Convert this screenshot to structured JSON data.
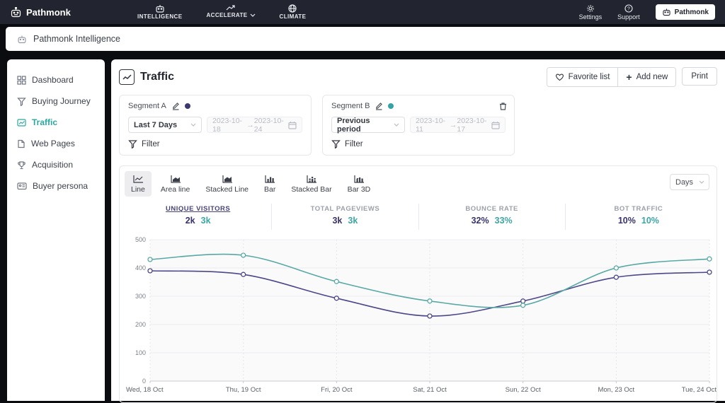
{
  "topbar": {
    "brand": "Pathmonk",
    "menu": [
      {
        "label": "INTELLIGENCE",
        "icon": "robot-icon",
        "chevron": false
      },
      {
        "label": "ACCELERATE",
        "icon": "trend-up-icon",
        "chevron": true
      },
      {
        "label": "CLIMATE",
        "icon": "globe-icon",
        "chevron": false
      }
    ],
    "actions": [
      {
        "label": "Settings",
        "icon": "gear-icon"
      },
      {
        "label": "Support",
        "icon": "help-icon"
      }
    ],
    "account_button": "Pathmonk"
  },
  "breadcrumb": {
    "label": "Pathmonk Intelligence",
    "icon": "robot-icon"
  },
  "sidebar": {
    "items": [
      {
        "label": "Dashboard",
        "icon": "dashboard-icon",
        "active": false
      },
      {
        "label": "Buying Journey",
        "icon": "funnel-icon",
        "active": false
      },
      {
        "label": "Traffic",
        "icon": "traffic-chart-icon",
        "active": true
      },
      {
        "label": "Web Pages",
        "icon": "document-icon",
        "active": false
      },
      {
        "label": "Acquisition",
        "icon": "trophy-icon",
        "active": false
      },
      {
        "label": "Buyer persona",
        "icon": "id-card-icon",
        "active": false
      }
    ]
  },
  "page": {
    "title": "Traffic",
    "favorite_button": "Favorite list",
    "add_new_button": "Add new",
    "print_button": "Print"
  },
  "segments": [
    {
      "name": "Segment A",
      "color": "#3c3870",
      "period": "Last 7 Days",
      "date_from": "2023-10-18",
      "date_to": "2023-10-24",
      "arrow": "→",
      "filter_label": "Filter",
      "deletable": false
    },
    {
      "name": "Segment B",
      "color": "#35a3a3",
      "period": "Previous period",
      "date_from": "2023-10-11",
      "date_to": "2023-10-17",
      "arrow": "→",
      "filter_label": "Filter",
      "deletable": true
    }
  ],
  "chart_controls": {
    "types": [
      {
        "label": "Line",
        "icon": "line-chart-icon",
        "active": true
      },
      {
        "label": "Area line",
        "icon": "area-chart-icon",
        "active": false
      },
      {
        "label": "Stacked Line",
        "icon": "stacked-area-icon",
        "active": false
      },
      {
        "label": "Bar",
        "icon": "bar-chart-icon",
        "active": false
      },
      {
        "label": "Stacked Bar",
        "icon": "stacked-bar-icon",
        "active": false
      },
      {
        "label": "Bar 3D",
        "icon": "bar-3d-icon",
        "active": false
      }
    ],
    "granularity": "Days"
  },
  "metrics": [
    {
      "label": "UNIQUE VISITORS",
      "value_a": "2k",
      "value_b": "3k",
      "active": true
    },
    {
      "label": "TOTAL PAGEVIEWS",
      "value_a": "3k",
      "value_b": "3k",
      "active": false
    },
    {
      "label": "BOUNCE RATE",
      "value_a": "32%",
      "value_b": "33%",
      "active": false
    },
    {
      "label": "BOT TRAFFIC",
      "value_a": "10%",
      "value_b": "10%",
      "active": false
    }
  ],
  "chart_data": {
    "type": "line",
    "x": [
      "Wed, 18 Oct",
      "Thu, 19 Oct",
      "Fri, 20 Oct",
      "Sat, 21 Oct",
      "Sun, 22 Oct",
      "Mon, 23 Oct",
      "Tue, 24 Oct"
    ],
    "series": [
      {
        "name": "Segment A",
        "color": "#4c4788",
        "values": [
          390,
          377,
          293,
          230,
          283,
          367,
          385
        ]
      },
      {
        "name": "Segment B",
        "color": "#58a9a5",
        "values": [
          430,
          445,
          352,
          283,
          268,
          400,
          432
        ]
      }
    ],
    "ylim": [
      0,
      500
    ],
    "yticks": [
      0,
      100,
      200,
      300,
      400,
      500
    ],
    "grid": true,
    "legend": "none",
    "smooth": true
  },
  "colors": {
    "topbar_bg": "#22252f",
    "page_bg": "#0b0c10",
    "card_bg": "#ffffff",
    "border": "#e6e7ec",
    "active_nav": "#2ba7a1",
    "segment_a": "#3c3870",
    "segment_b": "#35a3a3",
    "plot_bg": "#fafafa"
  },
  "icons": {
    "robot-icon": "robot head glyph",
    "trend-up-icon": "rising arrow",
    "globe-icon": "globe",
    "gear-icon": "settings gear",
    "help-icon": "question mark in circle",
    "dashboard-icon": "grid of squares",
    "funnel-icon": "filter funnel",
    "traffic-chart-icon": "line chart in box",
    "document-icon": "page with folded corner",
    "trophy-icon": "trophy cup",
    "id-card-icon": "persona card",
    "edit-pencil-icon": "pencil with underline",
    "trash-icon": "waste bin",
    "calendar-icon": "calendar",
    "heart-icon": "heart outline",
    "chevron-down-icon": "downward chevron",
    "plus-icon": "plus sign"
  }
}
